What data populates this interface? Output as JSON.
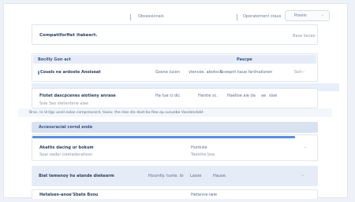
{
  "colors": {
    "accent": "#5b8fdb",
    "band": "#e6ecf7",
    "band_dark": "#d9e2f1"
  },
  "topbar": {
    "tab1": "Obsessionals",
    "tab2": "Operatement staus",
    "select_value": "Poseis",
    "chevron_icon": "chevron-down-icon"
  },
  "header_card": {
    "title": "Compatiforfiet itakeert.",
    "meta": "Base liecee"
  },
  "section1": {
    "header_left": "Bocilly Gon act",
    "header_right": "Pascpe",
    "row": {
      "a": "Cosels ne ardoste Anoiseat",
      "b": "Gosne lucen",
      "c": "vlencee. abotock",
      "d": "Sceepnt",
      "e": "kaue fariinalisnen",
      "f": "Soit"
    }
  },
  "section2": {
    "title": "Flotet dascpcenes aiotieny anrase",
    "sub": "Ssie 3ao stetentene alae",
    "cols": {
      "a": "Ha tue ci dic",
      "b": "Hantie sc.",
      "c": "Haelloe aie da",
      "d": "ae",
      "e": "sloe"
    }
  },
  "info_line": "Brac, le Ur(lgs ucoll ealas compreocord, tiaoiv. the Hoe ste dsat-bo  Rea op.susuebe  Vascblsdobt",
  "section3": {
    "band": "Accessracial cornd ende",
    "title": "Akaths dacing ur bokum",
    "sub": "Sear eadel cieetaderatlexn",
    "right": "Huntisle",
    "sub_right": "Taekthe boe"
  },
  "section4": {
    "title": "Biat temenoy ho atande diekearm",
    "a": "Houmlly. tunte. to",
    "b": "Laisie",
    "c": "Hause."
  },
  "section5": {
    "title": "Hetalsen-anoe'Sbate Bsou",
    "right": "Hetanne-iwie"
  }
}
